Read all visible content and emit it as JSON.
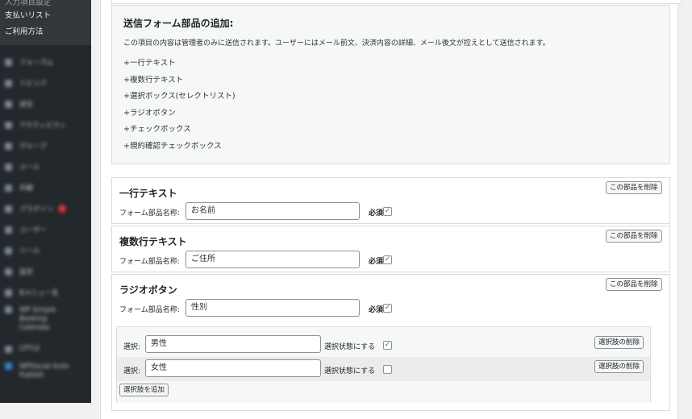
{
  "sidebar": {
    "top_items": [
      {
        "label": "入力項目設定",
        "faded": true
      },
      {
        "label": "支払いリスト"
      },
      {
        "label": "ご利用方法"
      }
    ],
    "blurred_items": [
      {
        "label": "フォーラム"
      },
      {
        "label": "トピック"
      },
      {
        "label": "返信"
      },
      {
        "label": "アクティビティ"
      },
      {
        "label": "グループ"
      },
      {
        "label": "メール"
      },
      {
        "label": "外観"
      },
      {
        "label": "プラグイン",
        "badge": true
      },
      {
        "label": "ユーザー"
      },
      {
        "label": "ツール"
      },
      {
        "label": "設定"
      },
      {
        "label": "Bメニュー名"
      },
      {
        "label": "WP Simple Booking Calendar",
        "tall": true
      },
      {
        "label": "CPTUI"
      },
      {
        "label": "WPSocial Auto Publish",
        "tall": true,
        "blue": true
      }
    ]
  },
  "info": {
    "title": "送信フォーム部品の追加:",
    "description": "この項目の内容は管理者のみに送信されます。ユーザーにはメール前文、決済内容の詳細、メール後文が控えとして送信されます。",
    "items": [
      "+一行テキスト",
      "+複数行テキスト",
      "+選択ボックス(セレクトリスト)",
      "+ラジオボタン",
      "+チェックボックス",
      "+規約確認チェックボックス"
    ]
  },
  "parts": [
    {
      "title": "一行テキスト",
      "name_label": "フォーム部品名称:",
      "value": "お名前",
      "required_label": "必須",
      "required": true,
      "delete_label": "この部品を削除"
    },
    {
      "title": "複数行テキスト",
      "name_label": "フォーム部品名称:",
      "value": "ご住所",
      "required_label": "必須",
      "required": true,
      "delete_label": "この部品を削除"
    },
    {
      "title": "ラジオボタン",
      "name_label": "フォーム部品名称:",
      "value": "性別",
      "required_label": "必須",
      "required": true,
      "delete_label": "この部品を削除"
    }
  ],
  "choices": {
    "rows": [
      {
        "label": "選択:",
        "value": "男性",
        "selected_label": "選択状態にする",
        "selected": true,
        "delete_label": "選択肢の削除"
      },
      {
        "label": "選択:",
        "value": "女性",
        "selected_label": "選択状態にする",
        "selected": false,
        "delete_label": "選択肢の削除"
      }
    ],
    "add_label": "選択肢を追加"
  },
  "colors": {
    "sidebar_bg": "#23282d",
    "accent": "#2271b1",
    "badge": "#d63638"
  }
}
